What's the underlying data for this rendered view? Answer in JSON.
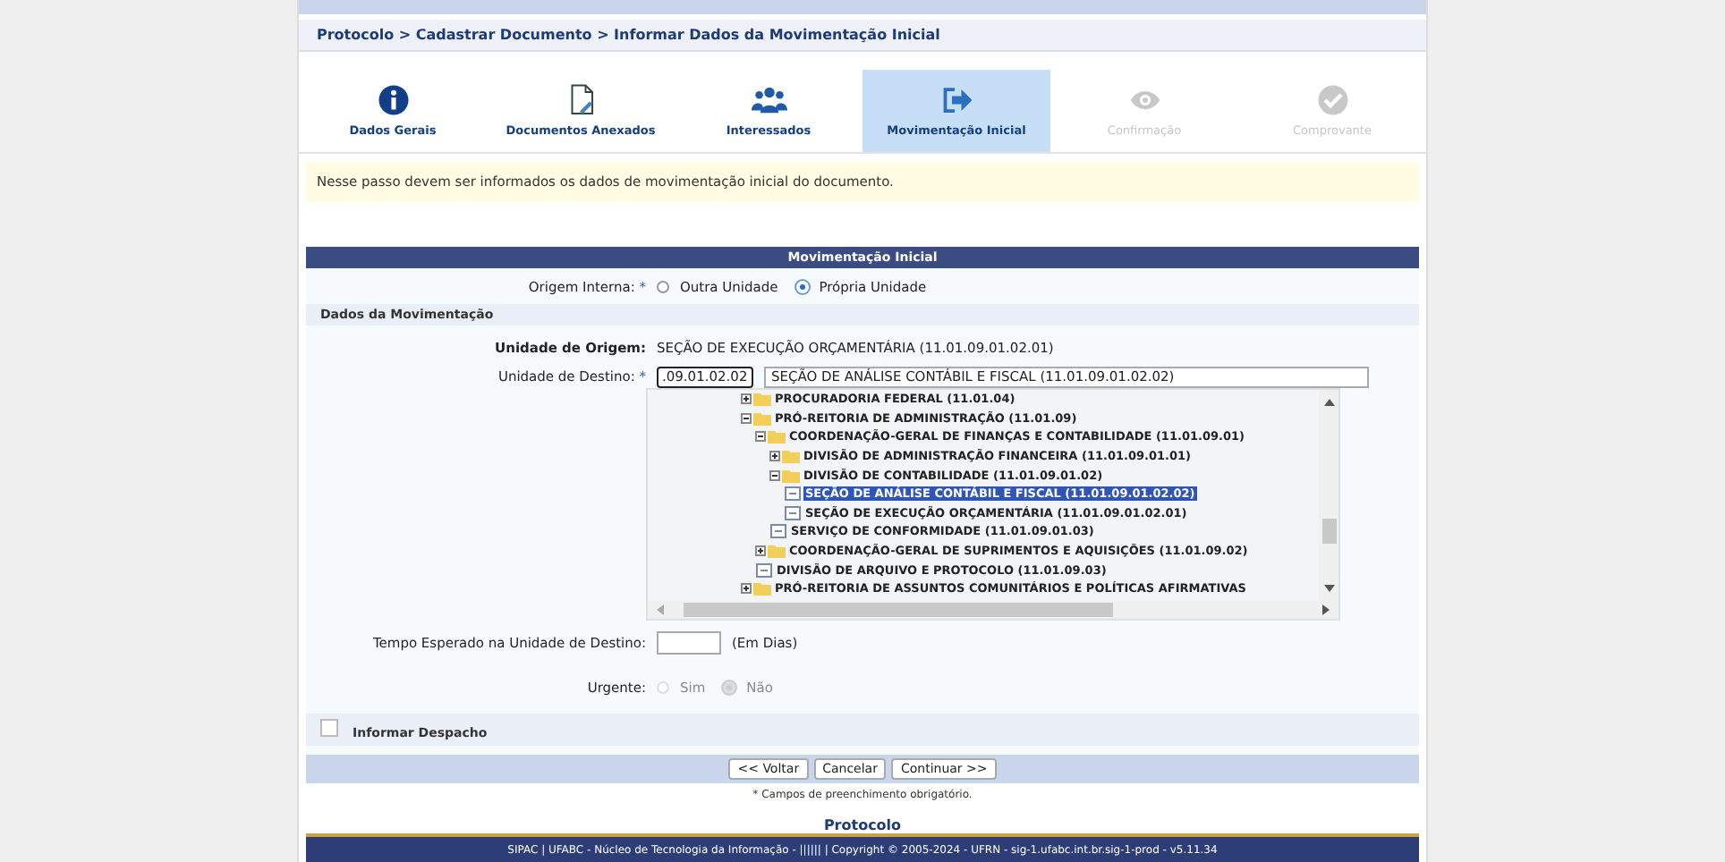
{
  "breadcrumb": "Protocolo > Cadastrar Documento > Informar Dados da Movimentação Inicial",
  "steps": [
    {
      "kind": "info",
      "label": "Dados Gerais",
      "selected": false,
      "disabled": false
    },
    {
      "kind": "document",
      "label": "Documentos Anexados",
      "selected": false,
      "disabled": false
    },
    {
      "kind": "people",
      "label": "Interessados",
      "selected": false,
      "disabled": false
    },
    {
      "kind": "move",
      "label": "Movimentação Inicial",
      "selected": true,
      "disabled": false
    },
    {
      "kind": "eye",
      "label": "Confirmação",
      "selected": false,
      "disabled": true
    },
    {
      "kind": "check",
      "label": "Comprovante",
      "selected": false,
      "disabled": true
    }
  ],
  "info_message": "Nesse passo devem ser informados os dados de movimentação inicial do documento.",
  "form": {
    "title": "Movimentação Inicial",
    "origem_interna": {
      "label": "Origem Interna:",
      "required_mark": "*",
      "options": [
        {
          "label": "Outra Unidade",
          "selected": false
        },
        {
          "label": "Própria Unidade",
          "selected": true
        }
      ]
    },
    "section_title": "Dados da Movimentação",
    "unidade_origem": {
      "label": "Unidade de Origem:",
      "value": "SEÇÃO DE EXECUÇÃO ORÇAMENTÁRIA (11.01.09.01.02.01)"
    },
    "unidade_destino": {
      "label": "Unidade de Destino:",
      "required_mark": "*",
      "code": ".09.01.02.02",
      "name": "SEÇÃO DE ANÁLISE CONTÁBIL E FISCAL (11.01.09.01.02.02)"
    },
    "tree": [
      {
        "kind": "folder",
        "label": "PROCURADORIA FEDERAL (11.01.04)",
        "expanded": false,
        "selected": false
      },
      {
        "kind": "folder",
        "label": "PRÓ-REITORIA DE ADMINISTRAÇÃO (11.01.09)",
        "expanded": true,
        "selected": false,
        "children": [
          {
            "kind": "folder",
            "label": "COORDENAÇÃO-GERAL DE FINANÇAS E CONTABILIDADE (11.01.09.01)",
            "expanded": true,
            "selected": false,
            "children": [
              {
                "kind": "folder",
                "label": "DIVISÃO DE ADMINISTRAÇÃO FINANCEIRA (11.01.09.01.01)",
                "expanded": false,
                "selected": false
              },
              {
                "kind": "folder",
                "label": "DIVISÃO DE CONTABILIDADE (11.01.09.01.02)",
                "expanded": true,
                "selected": false,
                "children": [
                  {
                    "kind": "leaf",
                    "label": "SEÇÃO DE ANÁLISE CONTÁBIL E FISCAL (11.01.09.01.02.02)",
                    "selected": true
                  },
                  {
                    "kind": "leaf",
                    "label": "SEÇÃO DE EXECUÇÃO ORÇAMENTÁRIA (11.01.09.01.02.01)",
                    "selected": false
                  }
                ]
              },
              {
                "kind": "leaf",
                "label": "SERVIÇO DE CONFORMIDADE (11.01.09.01.03)",
                "selected": false
              }
            ]
          },
          {
            "kind": "folder",
            "label": "COORDENAÇÃO-GERAL DE SUPRIMENTOS E AQUISIÇÕES (11.01.09.02)",
            "expanded": false,
            "selected": false
          },
          {
            "kind": "leaf",
            "label": "DIVISÃO DE ARQUIVO E PROTOCOLO (11.01.09.03)",
            "selected": false
          }
        ]
      },
      {
        "kind": "folder",
        "label": "PRÓ-REITORIA DE ASSUNTOS COMUNITÁRIOS E POLÍTICAS AFIRMATIVAS",
        "expanded": false,
        "selected": false
      }
    ],
    "tempo_esperado": {
      "label": "Tempo Esperado na Unidade de Destino:",
      "unit": "(Em Dias)"
    },
    "urgente": {
      "label": "Urgente:",
      "options": [
        {
          "label": "Sim",
          "selected": false,
          "disabled": true
        },
        {
          "label": "Não",
          "selected": true,
          "disabled": true
        }
      ]
    },
    "informar_despacho": {
      "label": "Informar Despacho",
      "checked": false
    },
    "buttons": [
      "<< Voltar",
      "Cancelar",
      "Continuar >>"
    ]
  },
  "required_note": "* Campos de preenchimento obrigatório.",
  "module_link": "Protocolo",
  "footer": "SIPAC | UFABC - Núcleo de Tecnologia da Informação - |||||| | Copyright © 2005-2024 - UFRN - sig-1.ufabc.int.br.sig-1-prod - v5.11.34"
}
